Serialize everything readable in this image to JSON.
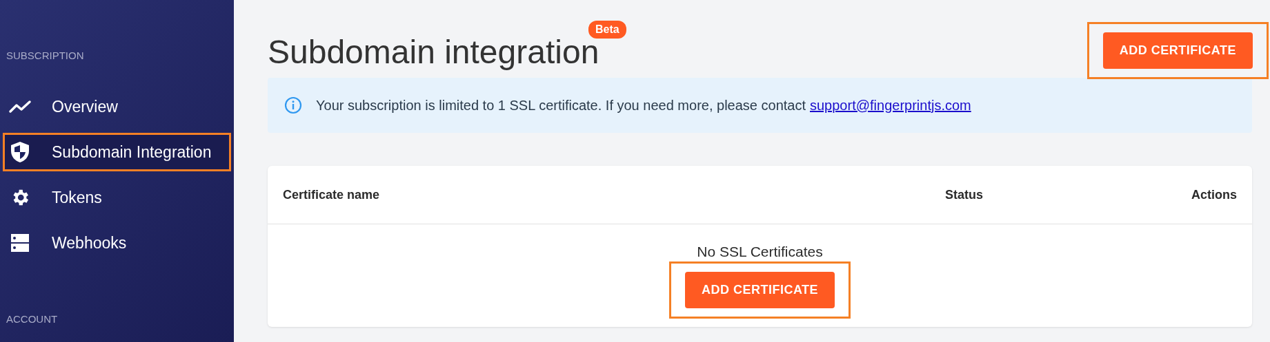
{
  "sidebar": {
    "sections": [
      {
        "label": "SUBSCRIPTION",
        "items": [
          {
            "label": "Overview",
            "selected": false,
            "highlighted": false
          },
          {
            "label": "Subdomain Integration",
            "selected": true,
            "highlighted": true
          },
          {
            "label": "Tokens",
            "selected": false,
            "highlighted": false
          },
          {
            "label": "Webhooks",
            "selected": false,
            "highlighted": false
          }
        ]
      },
      {
        "label": "ACCOUNT"
      }
    ]
  },
  "header": {
    "title": "Subdomain integration",
    "badge": "Beta",
    "button": {
      "label": "ADD CERTIFICATE",
      "highlighted": true
    }
  },
  "notice": {
    "text": "Your subscription is limited to 1 SSL certificate. If you need more, please contact",
    "link": "support@fingerprintjs.com"
  },
  "table": {
    "columns": [
      "Certificate name",
      "Status",
      "Actions"
    ],
    "empty_text": "No SSL Certificates",
    "empty_button": {
      "label": "ADD CERTIFICATE",
      "highlighted": true
    }
  }
}
